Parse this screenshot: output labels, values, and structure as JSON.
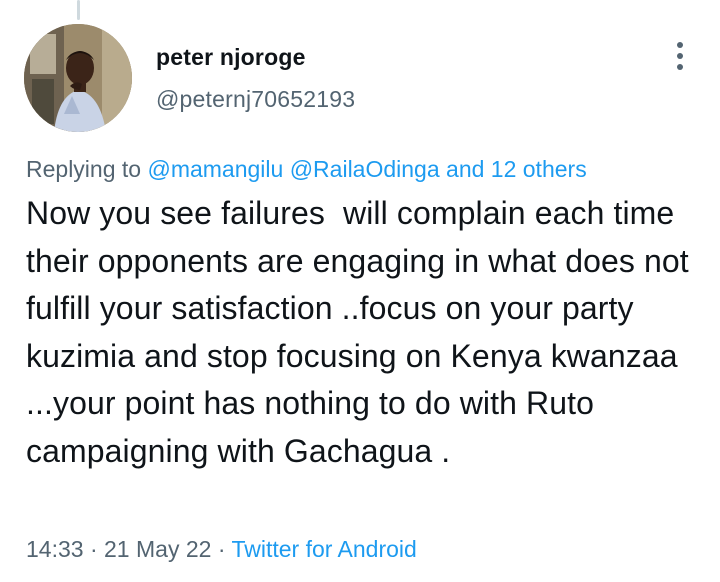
{
  "author": {
    "display_name": "peter njoroge",
    "handle": "@peternj70652193"
  },
  "reply_context": {
    "prefix": "Replying to",
    "mentions": [
      "@mamangilu",
      "@RailaOdinga"
    ],
    "others": "and 12 others"
  },
  "tweet": {
    "text": "Now you see failures  will complain each time their opponents are engaging in what does not fulfill your satisfaction ..focus on your party kuzimia and stop focusing on Kenya kwanzaa ...your point has nothing to do with Ruto campaigning with Gachagua ."
  },
  "meta": {
    "time": "14:33",
    "separator": "·",
    "date": "21 May 22",
    "source": "Twitter for Android"
  },
  "colors": {
    "text": "#0f1419",
    "muted": "#536471",
    "link": "#1d9bf0"
  },
  "icons": {
    "more": "more-vertical-icon"
  }
}
